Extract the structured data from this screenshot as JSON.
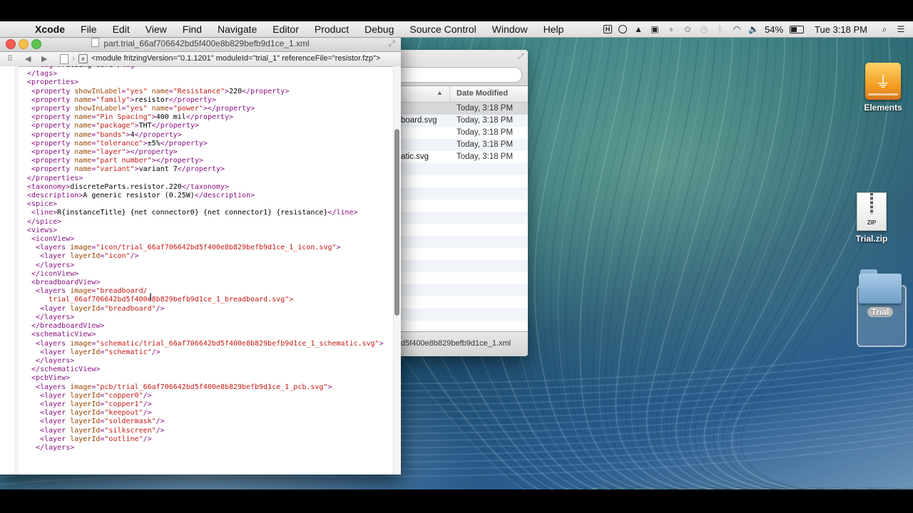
{
  "menubar": {
    "app_name": "Xcode",
    "items": [
      "File",
      "Edit",
      "View",
      "Find",
      "Navigate",
      "Editor",
      "Product",
      "Debug",
      "Source Control",
      "Window",
      "Help"
    ],
    "battery_percent": "54%",
    "battery_level": 0.54,
    "clock": "Tue 3:18 PM"
  },
  "editor": {
    "title": "part.trial_66af706642bd5f400e8b829befb9d1ce_1.xml",
    "jumpbar_text": "<module fritzingVersion=\"0.1.1201\" moduleId=\"trial_1\" referenceFile=\"resistor.fzp\">",
    "lines": [
      "  <tag>fritzing core</tag>",
      "</tags>",
      "<properties>",
      " <property showInLabel=\"yes\" name=\"Resistance\">220</property>",
      " <property name=\"family\">resistor</property>",
      " <property showInLabel=\"yes\" name=\"power\"></property>",
      " <property name=\"Pin Spacing\">400 mil</property>",
      " <property name=\"package\">THT</property>",
      " <property name=\"bands\">4</property>",
      " <property name=\"tolerance\">±5%</property>",
      " <property name=\"layer\"></property>",
      " <property name=\"part number\"></property>",
      " <property name=\"variant\">variant 7</property>",
      "</properties>",
      "<taxonomy>discreteParts.resistor.220</taxonomy>",
      "<description>A generic resistor (0.25W)</description>",
      "<spice>",
      " <line>R{instanceTitle} {net connector0} {net connector1} {resistance}</line>",
      "</spice>",
      "<views>",
      " <iconView>",
      "  <layers image=\"icon/trial_66af706642bd5f400e8b829befb9d1ce_1_icon.svg\">",
      "   <layer layerId=\"icon\"/>",
      "  </layers>",
      " </iconView>",
      " <breadboardView>",
      "  <layers image=\"breadboard/",
      "     trial_66af706642bd5f400e8b829befb9d1ce_1_breadboard.svg\">",
      "   <layer layerId=\"breadboard\"/>",
      "  </layers>",
      " </breadboardView>",
      " <schematicView>",
      "  <layers image=\"schematic/trial_66af706642bd5f400e8b829befb9d1ce_1_schematic.svg\">",
      "   <layer layerId=\"schematic\"/>",
      "  </layers>",
      " </schematicView>",
      " <pcbView>",
      "  <layers image=\"pcb/trial_66af706642bd5f400e8b829befb9d1ce_1_pcb.svg\">",
      "   <layer layerId=\"copper0\"/>",
      "   <layer layerId=\"copper1\"/>",
      "   <layer layerId=\"keepout\"/>",
      "   <layer layerId=\"soldermask\"/>",
      "   <layer layerId=\"silkscreen\"/>",
      "   <layer layerId=\"outline\"/>",
      "  </layers>"
    ]
  },
  "finder": {
    "date_column": "Date Modified",
    "rows": [
      {
        "name": "",
        "date": "Today, 3:18 PM"
      },
      {
        "name": "board.svg",
        "date": "Today, 3:18 PM"
      },
      {
        "name": "",
        "date": "Today, 3:18 PM"
      },
      {
        "name": "",
        "date": "Today, 3:18 PM"
      },
      {
        "name": "atic.svg",
        "date": "Today, 3:18 PM"
      }
    ],
    "path_text": "d5f400e8b829befb9d1ce_1.xml"
  },
  "desktop": {
    "elements_label": "Elements",
    "zip_label": "Trial.zip",
    "zip_badge": "ZIP",
    "folder_label": "Trial"
  },
  "colors": {
    "xml_tag": "#881280",
    "xml_attr": "#994500",
    "xml_value": "#c41a16"
  }
}
